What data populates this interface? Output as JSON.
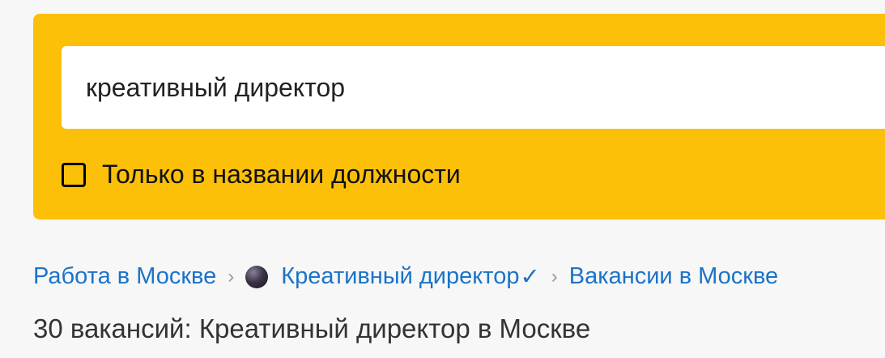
{
  "search": {
    "query": "креативный директор",
    "title_only_checkbox_label": "Только в названии должности",
    "title_only_checked": false
  },
  "breadcrumb": {
    "items": [
      {
        "label": "Работа в Москве"
      },
      {
        "label": "Креативный директор",
        "verified_mark": "✓"
      },
      {
        "label": "Вакансии в Москве"
      }
    ],
    "separator": "›"
  },
  "page": {
    "title": "30 вакансий: Креативный директор в Москве"
  },
  "colors": {
    "panel": "#fdc009",
    "link": "#1a73c9",
    "text": "#333333"
  }
}
